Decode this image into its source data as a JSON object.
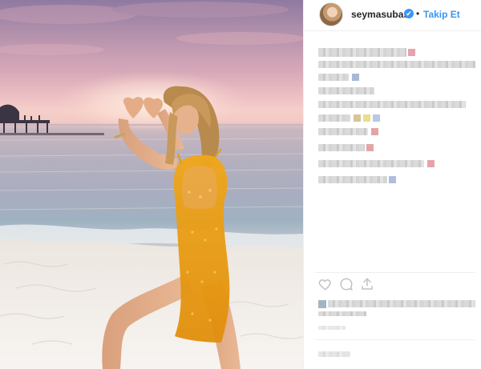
{
  "post": {
    "username": "seymasubasi",
    "verified_mark": "✔",
    "separator": "•",
    "follow_label": "Takip Et"
  },
  "colors": {
    "link_blue": "#3897f0",
    "text_dark": "#262626",
    "border": "#efefef"
  },
  "icons": {
    "like": "heart-icon",
    "comment": "comment-icon",
    "share": "share-icon"
  }
}
